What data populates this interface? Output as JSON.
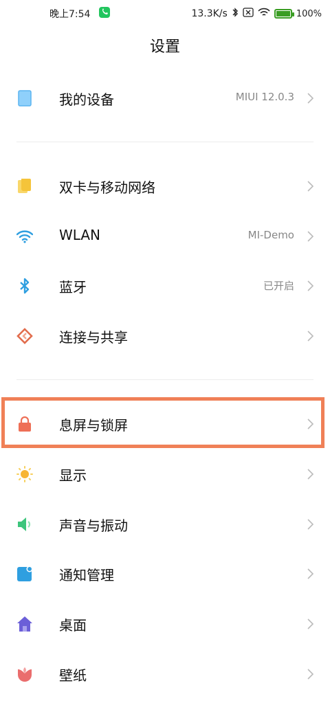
{
  "status_bar": {
    "time": "晚上7:54",
    "speed": "13.3K/s",
    "battery_pct": "100%"
  },
  "header": {
    "title": "设置"
  },
  "rows": {
    "my_device": {
      "label": "我的设备",
      "value": "MIUI 12.0.3"
    },
    "dual_sim": {
      "label": "双卡与移动网络"
    },
    "wlan": {
      "label": "WLAN",
      "value": "MI-Demo"
    },
    "bluetooth": {
      "label": "蓝牙",
      "value": "已开启"
    },
    "connect_share": {
      "label": "连接与共享"
    },
    "lock_screen": {
      "label": "息屏与锁屏"
    },
    "display": {
      "label": "显示"
    },
    "sound": {
      "label": "声音与振动"
    },
    "notifications": {
      "label": "通知管理"
    },
    "home": {
      "label": "桌面"
    },
    "wallpaper": {
      "label": "壁纸"
    }
  },
  "colors": {
    "highlight": "#f08057",
    "device_icon": "#5ab4f0",
    "sim_icon": "#f5c43a",
    "wlan_icon": "#2f9fe0",
    "bluetooth_icon": "#2f9fe0",
    "connect_icon": "#e26d4d",
    "lock_icon": "#ee6f56",
    "display_icon": "#f7b534",
    "sound_icon": "#3dc57c",
    "notification_icon": "#2f9fe0",
    "home_icon": "#6b5fd8",
    "wallpaper_icon": "#ea6d6d"
  }
}
